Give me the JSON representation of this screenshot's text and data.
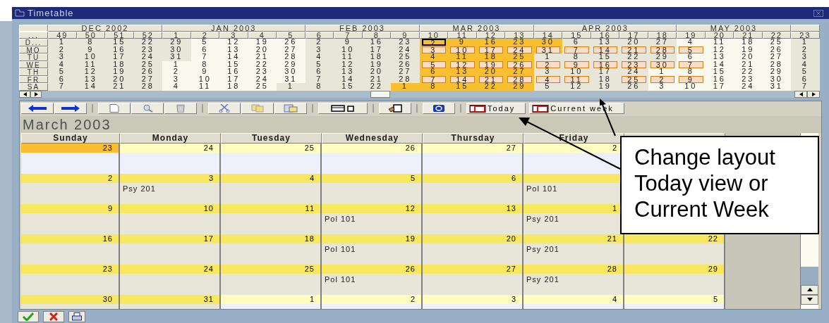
{
  "window": {
    "title": "Timetable"
  },
  "year_calendar": {
    "corner_label": "...",
    "day_labels": [
      "D...",
      "MO",
      "TU",
      "WE",
      "TH",
      "FR",
      "SA"
    ],
    "months": [
      {
        "label": "DEC 2002",
        "weeks": [
          {
            "number": "49",
            "days": [
              {
                "text": "1",
                "kind": "dark",
                "marked": false,
                "selected": false
              },
              {
                "text": "2",
                "kind": "dark",
                "marked": false,
                "selected": false
              },
              {
                "text": "3",
                "kind": "dark",
                "marked": false,
                "selected": false
              },
              {
                "text": "4",
                "kind": "dark",
                "marked": false,
                "selected": false
              },
              {
                "text": "5",
                "kind": "dark",
                "marked": false,
                "selected": false
              },
              {
                "text": "6",
                "kind": "dark",
                "marked": false,
                "selected": false
              },
              {
                "text": "7",
                "kind": "dark",
                "marked": false,
                "selected": false
              }
            ]
          },
          {
            "number": "50",
            "days": [
              {
                "text": "8",
                "kind": "dark",
                "marked": false,
                "selected": false
              },
              {
                "text": "9",
                "kind": "dark",
                "marked": false,
                "selected": false
              },
              {
                "text": "10",
                "kind": "dark",
                "marked": false,
                "selected": false
              },
              {
                "text": "11",
                "kind": "dark",
                "marked": false,
                "selected": false
              },
              {
                "text": "12",
                "kind": "dark",
                "marked": false,
                "selected": false
              },
              {
                "text": "13",
                "kind": "dark",
                "marked": false,
                "selected": false
              },
              {
                "text": "14",
                "kind": "dark",
                "marked": false,
                "selected": false
              }
            ]
          },
          {
            "number": "51",
            "days": [
              {
                "text": "15",
                "kind": "dark",
                "marked": false,
                "selected": false
              },
              {
                "text": "16",
                "kind": "dark",
                "marked": false,
                "selected": false
              },
              {
                "text": "17",
                "kind": "dark",
                "marked": false,
                "selected": false
              },
              {
                "text": "18",
                "kind": "dark",
                "marked": false,
                "selected": false
              },
              {
                "text": "19",
                "kind": "dark",
                "marked": false,
                "selected": false
              },
              {
                "text": "20",
                "kind": "dark",
                "marked": false,
                "selected": false
              },
              {
                "text": "21",
                "kind": "dark",
                "marked": false,
                "selected": false
              }
            ]
          },
          {
            "number": "52",
            "days": [
              {
                "text": "22",
                "kind": "dark",
                "marked": false,
                "selected": false
              },
              {
                "text": "23",
                "kind": "dark",
                "marked": false,
                "selected": false
              },
              {
                "text": "24",
                "kind": "dark",
                "marked": false,
                "selected": false
              },
              {
                "text": "25",
                "kind": "dark",
                "marked": false,
                "selected": false
              },
              {
                "text": "26",
                "kind": "dark",
                "marked": false,
                "selected": false
              },
              {
                "text": "27",
                "kind": "dark",
                "marked": false,
                "selected": false
              },
              {
                "text": "28",
                "kind": "dark",
                "marked": false,
                "selected": false
              }
            ]
          }
        ]
      },
      {
        "label": "JAN 2003",
        "weeks": [
          {
            "number": "1",
            "days": [
              {
                "text": "29",
                "kind": "dark",
                "marked": false,
                "selected": false
              },
              {
                "text": "30",
                "kind": "dark",
                "marked": false,
                "selected": false
              },
              {
                "text": "31",
                "kind": "dark",
                "marked": false,
                "selected": false
              },
              {
                "text": "1",
                "kind": "light",
                "marked": false,
                "selected": false
              },
              {
                "text": "2",
                "kind": "light",
                "marked": false,
                "selected": false
              },
              {
                "text": "3",
                "kind": "light",
                "marked": false,
                "selected": false
              },
              {
                "text": "4",
                "kind": "light",
                "marked": false,
                "selected": false
              }
            ]
          },
          {
            "number": "2",
            "days": [
              {
                "text": "5",
                "kind": "light",
                "marked": false,
                "selected": false
              },
              {
                "text": "6",
                "kind": "light",
                "marked": false,
                "selected": false
              },
              {
                "text": "7",
                "kind": "light",
                "marked": false,
                "selected": false
              },
              {
                "text": "8",
                "kind": "light",
                "marked": false,
                "selected": false
              },
              {
                "text": "9",
                "kind": "light",
                "marked": false,
                "selected": false
              },
              {
                "text": "10",
                "kind": "light",
                "marked": false,
                "selected": false
              },
              {
                "text": "11",
                "kind": "light",
                "marked": false,
                "selected": false
              }
            ]
          },
          {
            "number": "3",
            "days": [
              {
                "text": "12",
                "kind": "light",
                "marked": false,
                "selected": false
              },
              {
                "text": "13",
                "kind": "light",
                "marked": false,
                "selected": false
              },
              {
                "text": "14",
                "kind": "light",
                "marked": false,
                "selected": false
              },
              {
                "text": "15",
                "kind": "light",
                "marked": false,
                "selected": false
              },
              {
                "text": "16",
                "kind": "light",
                "marked": false,
                "selected": false
              },
              {
                "text": "17",
                "kind": "light",
                "marked": false,
                "selected": false
              },
              {
                "text": "18",
                "kind": "light",
                "marked": false,
                "selected": false
              }
            ]
          },
          {
            "number": "4",
            "days": [
              {
                "text": "19",
                "kind": "light",
                "marked": false,
                "selected": false
              },
              {
                "text": "20",
                "kind": "light",
                "marked": false,
                "selected": false
              },
              {
                "text": "21",
                "kind": "light",
                "marked": false,
                "selected": false
              },
              {
                "text": "22",
                "kind": "light",
                "marked": false,
                "selected": false
              },
              {
                "text": "23",
                "kind": "light",
                "marked": false,
                "selected": false
              },
              {
                "text": "24",
                "kind": "light",
                "marked": false,
                "selected": false
              },
              {
                "text": "25",
                "kind": "light",
                "marked": false,
                "selected": false
              }
            ]
          },
          {
            "number": "5",
            "days": [
              {
                "text": "26",
                "kind": "light",
                "marked": false,
                "selected": false
              },
              {
                "text": "27",
                "kind": "light",
                "marked": false,
                "selected": false
              },
              {
                "text": "28",
                "kind": "light",
                "marked": false,
                "selected": false
              },
              {
                "text": "29",
                "kind": "light",
                "marked": false,
                "selected": false
              },
              {
                "text": "30",
                "kind": "light",
                "marked": false,
                "selected": false
              },
              {
                "text": "31",
                "kind": "light",
                "marked": false,
                "selected": false
              },
              {
                "text": "1",
                "kind": "dark",
                "marked": false,
                "selected": false
              }
            ]
          }
        ]
      },
      {
        "label": "FEB 2003",
        "weeks": [
          {
            "number": "6",
            "days": [
              {
                "text": "2",
                "kind": "dark",
                "marked": false,
                "selected": false
              },
              {
                "text": "3",
                "kind": "dark",
                "marked": false,
                "selected": false
              },
              {
                "text": "4",
                "kind": "dark",
                "marked": false,
                "selected": false
              },
              {
                "text": "5",
                "kind": "dark",
                "marked": false,
                "selected": false
              },
              {
                "text": "6",
                "kind": "dark",
                "marked": false,
                "selected": false
              },
              {
                "text": "7",
                "kind": "dark",
                "marked": false,
                "selected": false
              },
              {
                "text": "8",
                "kind": "dark",
                "marked": false,
                "selected": false
              }
            ]
          },
          {
            "number": "7",
            "days": [
              {
                "text": "9",
                "kind": "dark",
                "marked": false,
                "selected": false
              },
              {
                "text": "10",
                "kind": "dark",
                "marked": false,
                "selected": false
              },
              {
                "text": "11",
                "kind": "dark",
                "marked": false,
                "selected": false
              },
              {
                "text": "12",
                "kind": "dark",
                "marked": false,
                "selected": false
              },
              {
                "text": "13",
                "kind": "dark",
                "marked": false,
                "selected": false
              },
              {
                "text": "14",
                "kind": "dark",
                "marked": false,
                "selected": false
              },
              {
                "text": "15",
                "kind": "dark",
                "marked": false,
                "selected": false
              }
            ]
          },
          {
            "number": "8",
            "days": [
              {
                "text": "16",
                "kind": "dark",
                "marked": false,
                "selected": false
              },
              {
                "text": "17",
                "kind": "dark",
                "marked": false,
                "selected": false
              },
              {
                "text": "18",
                "kind": "dark",
                "marked": false,
                "selected": false
              },
              {
                "text": "19",
                "kind": "dark",
                "marked": false,
                "selected": false
              },
              {
                "text": "20",
                "kind": "dark",
                "marked": false,
                "selected": false
              },
              {
                "text": "21",
                "kind": "dark",
                "marked": false,
                "selected": false
              },
              {
                "text": "22",
                "kind": "dark",
                "marked": false,
                "selected": false
              }
            ]
          },
          {
            "number": "9",
            "days": [
              {
                "text": "23",
                "kind": "dark",
                "marked": false,
                "selected": false
              },
              {
                "text": "24",
                "kind": "dark",
                "marked": false,
                "selected": false
              },
              {
                "text": "25",
                "kind": "dark",
                "marked": false,
                "selected": false
              },
              {
                "text": "26",
                "kind": "dark",
                "marked": false,
                "selected": false
              },
              {
                "text": "27",
                "kind": "dark",
                "marked": false,
                "selected": false
              },
              {
                "text": "28",
                "kind": "dark",
                "marked": false,
                "selected": false
              },
              {
                "text": "1",
                "kind": "highlight",
                "marked": false,
                "selected": false
              }
            ]
          }
        ]
      },
      {
        "label": "MAR 2003",
        "weeks": [
          {
            "number": "10",
            "days": [
              {
                "text": "2",
                "kind": "highlight",
                "marked": false,
                "selected": true
              },
              {
                "text": "3",
                "kind": "highlight",
                "marked": true,
                "selected": false
              },
              {
                "text": "4",
                "kind": "highlight",
                "marked": false,
                "selected": false
              },
              {
                "text": "5",
                "kind": "highlight",
                "marked": true,
                "selected": false
              },
              {
                "text": "6",
                "kind": "highlight",
                "marked": false,
                "selected": false
              },
              {
                "text": "7",
                "kind": "highlight",
                "marked": true,
                "selected": false
              },
              {
                "text": "8",
                "kind": "highlight",
                "marked": false,
                "selected": false
              }
            ]
          },
          {
            "number": "11",
            "days": [
              {
                "text": "9",
                "kind": "highlight",
                "marked": false,
                "selected": false
              },
              {
                "text": "10",
                "kind": "highlight",
                "marked": true,
                "selected": false
              },
              {
                "text": "11",
                "kind": "highlight",
                "marked": false,
                "selected": false
              },
              {
                "text": "12",
                "kind": "highlight",
                "marked": true,
                "selected": false
              },
              {
                "text": "13",
                "kind": "highlight",
                "marked": false,
                "selected": false
              },
              {
                "text": "14",
                "kind": "highlight",
                "marked": true,
                "selected": false
              },
              {
                "text": "15",
                "kind": "highlight",
                "marked": false,
                "selected": false
              }
            ]
          },
          {
            "number": "12",
            "days": [
              {
                "text": "16",
                "kind": "highlight",
                "marked": false,
                "selected": false
              },
              {
                "text": "17",
                "kind": "highlight",
                "marked": true,
                "selected": false
              },
              {
                "text": "18",
                "kind": "highlight",
                "marked": false,
                "selected": false
              },
              {
                "text": "19",
                "kind": "highlight",
                "marked": true,
                "selected": false
              },
              {
                "text": "20",
                "kind": "highlight",
                "marked": false,
                "selected": false
              },
              {
                "text": "21",
                "kind": "highlight",
                "marked": true,
                "selected": false
              },
              {
                "text": "22",
                "kind": "highlight",
                "marked": false,
                "selected": false
              }
            ]
          },
          {
            "number": "13",
            "days": [
              {
                "text": "23",
                "kind": "highlight",
                "marked": false,
                "selected": false
              },
              {
                "text": "24",
                "kind": "highlight",
                "marked": true,
                "selected": false
              },
              {
                "text": "25",
                "kind": "highlight",
                "marked": false,
                "selected": false
              },
              {
                "text": "26",
                "kind": "highlight",
                "marked": true,
                "selected": false
              },
              {
                "text": "27",
                "kind": "highlight",
                "marked": false,
                "selected": false
              },
              {
                "text": "28",
                "kind": "highlight",
                "marked": true,
                "selected": false
              },
              {
                "text": "29",
                "kind": "highlight",
                "marked": false,
                "selected": false
              }
            ]
          }
        ]
      },
      {
        "label": "APR 2003",
        "weeks": [
          {
            "number": "14",
            "days": [
              {
                "text": "30",
                "kind": "highlight",
                "marked": false,
                "selected": false
              },
              {
                "text": "31",
                "kind": "highlight",
                "marked": true,
                "selected": false
              },
              {
                "text": "1",
                "kind": "dark",
                "marked": false,
                "selected": false
              },
              {
                "text": "2",
                "kind": "dark",
                "marked": true,
                "selected": false
              },
              {
                "text": "3",
                "kind": "dark",
                "marked": false,
                "selected": false
              },
              {
                "text": "4",
                "kind": "dark",
                "marked": true,
                "selected": false
              },
              {
                "text": "5",
                "kind": "dark",
                "marked": false,
                "selected": false
              }
            ]
          },
          {
            "number": "15",
            "days": [
              {
                "text": "6",
                "kind": "dark",
                "marked": false,
                "selected": false
              },
              {
                "text": "7",
                "kind": "dark",
                "marked": true,
                "selected": false
              },
              {
                "text": "8",
                "kind": "dark",
                "marked": false,
                "selected": false
              },
              {
                "text": "9",
                "kind": "dark",
                "marked": true,
                "selected": false
              },
              {
                "text": "10",
                "kind": "dark",
                "marked": false,
                "selected": false
              },
              {
                "text": "11",
                "kind": "dark",
                "marked": true,
                "selected": false
              },
              {
                "text": "12",
                "kind": "dark",
                "marked": false,
                "selected": false
              }
            ]
          },
          {
            "number": "16",
            "days": [
              {
                "text": "13",
                "kind": "dark",
                "marked": false,
                "selected": false
              },
              {
                "text": "14",
                "kind": "dark",
                "marked": true,
                "selected": false
              },
              {
                "text": "15",
                "kind": "dark",
                "marked": false,
                "selected": false
              },
              {
                "text": "16",
                "kind": "dark",
                "marked": true,
                "selected": false
              },
              {
                "text": "17",
                "kind": "dark",
                "marked": false,
                "selected": false
              },
              {
                "text": "18",
                "kind": "dark",
                "marked": false,
                "selected": false
              },
              {
                "text": "19",
                "kind": "dark",
                "marked": false,
                "selected": false
              }
            ]
          },
          {
            "number": "17",
            "days": [
              {
                "text": "20",
                "kind": "dark",
                "marked": false,
                "selected": false
              },
              {
                "text": "21",
                "kind": "dark",
                "marked": true,
                "selected": false
              },
              {
                "text": "22",
                "kind": "dark",
                "marked": false,
                "selected": false
              },
              {
                "text": "23",
                "kind": "dark",
                "marked": true,
                "selected": false
              },
              {
                "text": "24",
                "kind": "dark",
                "marked": false,
                "selected": false
              },
              {
                "text": "25",
                "kind": "dark",
                "marked": true,
                "selected": false
              },
              {
                "text": "26",
                "kind": "dark",
                "marked": false,
                "selected": false
              }
            ]
          },
          {
            "number": "18",
            "days": [
              {
                "text": "27",
                "kind": "dark",
                "marked": false,
                "selected": false
              },
              {
                "text": "28",
                "kind": "dark",
                "marked": true,
                "selected": false
              },
              {
                "text": "29",
                "kind": "dark",
                "marked": false,
                "selected": false
              },
              {
                "text": "30",
                "kind": "dark",
                "marked": true,
                "selected": false
              },
              {
                "text": "1",
                "kind": "light",
                "marked": false,
                "selected": false
              },
              {
                "text": "2",
                "kind": "light",
                "marked": true,
                "selected": false
              },
              {
                "text": "3",
                "kind": "light",
                "marked": false,
                "selected": false
              }
            ]
          }
        ]
      },
      {
        "label": "MAY 2003",
        "weeks": [
          {
            "number": "19",
            "days": [
              {
                "text": "4",
                "kind": "light",
                "marked": false,
                "selected": false
              },
              {
                "text": "5",
                "kind": "light",
                "marked": true,
                "selected": false
              },
              {
                "text": "6",
                "kind": "light",
                "marked": false,
                "selected": false
              },
              {
                "text": "7",
                "kind": "light",
                "marked": true,
                "selected": false
              },
              {
                "text": "8",
                "kind": "light",
                "marked": false,
                "selected": false
              },
              {
                "text": "9",
                "kind": "light",
                "marked": true,
                "selected": false
              },
              {
                "text": "10",
                "kind": "light",
                "marked": false,
                "selected": false
              }
            ]
          },
          {
            "number": "20",
            "days": [
              {
                "text": "11",
                "kind": "light",
                "marked": false,
                "selected": false
              },
              {
                "text": "12",
                "kind": "light",
                "marked": false,
                "selected": false
              },
              {
                "text": "13",
                "kind": "light",
                "marked": false,
                "selected": false
              },
              {
                "text": "14",
                "kind": "light",
                "marked": false,
                "selected": false
              },
              {
                "text": "15",
                "kind": "light",
                "marked": false,
                "selected": false
              },
              {
                "text": "16",
                "kind": "light",
                "marked": false,
                "selected": false
              },
              {
                "text": "17",
                "kind": "light",
                "marked": false,
                "selected": false
              }
            ]
          },
          {
            "number": "21",
            "days": [
              {
                "text": "18",
                "kind": "light",
                "marked": false,
                "selected": false
              },
              {
                "text": "19",
                "kind": "light",
                "marked": false,
                "selected": false
              },
              {
                "text": "20",
                "kind": "light",
                "marked": false,
                "selected": false
              },
              {
                "text": "21",
                "kind": "light",
                "marked": false,
                "selected": false
              },
              {
                "text": "22",
                "kind": "light",
                "marked": false,
                "selected": false
              },
              {
                "text": "23",
                "kind": "light",
                "marked": false,
                "selected": false
              },
              {
                "text": "24",
                "kind": "light",
                "marked": false,
                "selected": false
              }
            ]
          },
          {
            "number": "22",
            "days": [
              {
                "text": "25",
                "kind": "light",
                "marked": false,
                "selected": false
              },
              {
                "text": "26",
                "kind": "light",
                "marked": false,
                "selected": false
              },
              {
                "text": "27",
                "kind": "light",
                "marked": false,
                "selected": false
              },
              {
                "text": "28",
                "kind": "light",
                "marked": false,
                "selected": false
              },
              {
                "text": "29",
                "kind": "light",
                "marked": false,
                "selected": false
              },
              {
                "text": "30",
                "kind": "light",
                "marked": false,
                "selected": false
              },
              {
                "text": "31",
                "kind": "light",
                "marked": false,
                "selected": false
              }
            ]
          }
        ]
      },
      {
        "weeks": [
          {
            "number": "23",
            "days": [
              {
                "text": "1",
                "kind": "dark",
                "marked": false,
                "selected": false
              },
              {
                "text": "2",
                "kind": "dark",
                "marked": false,
                "selected": false
              },
              {
                "text": "3",
                "kind": "dark",
                "marked": false,
                "selected": false
              },
              {
                "text": "4",
                "kind": "dark",
                "marked": false,
                "selected": false
              },
              {
                "text": "5",
                "kind": "dark",
                "marked": false,
                "selected": false
              },
              {
                "text": "6",
                "kind": "dark",
                "marked": false,
                "selected": false
              },
              {
                "text": "7",
                "kind": "dark",
                "marked": false,
                "selected": false
              }
            ]
          }
        ]
      }
    ]
  },
  "toolbar": {
    "buttons": [
      {
        "label": "Today"
      },
      {
        "label": "Current week"
      }
    ]
  },
  "month_view": {
    "title": "March 2003",
    "weekdays": [
      "Sunday",
      "Monday",
      "Tuesday",
      "Wednesday",
      "Thursday",
      "Friday"
    ],
    "weeks": [
      {
        "days": [
          {
            "date": "23",
            "in_month": false,
            "selected": true
          },
          {
            "date": "24",
            "in_month": false,
            "selected": false
          },
          {
            "date": "25",
            "in_month": false,
            "selected": false
          },
          {
            "date": "26",
            "in_month": false,
            "selected": false
          },
          {
            "date": "27",
            "in_month": false,
            "selected": false
          },
          {
            "date": "2",
            "in_month": false,
            "selected": false
          }
        ]
      },
      {
        "days": [
          {
            "date": "2",
            "in_month": true,
            "selected": false
          },
          {
            "date": "3",
            "in_month": true,
            "selected": false,
            "event": "Psy 201"
          },
          {
            "date": "4",
            "in_month": true,
            "selected": false
          },
          {
            "date": "5",
            "in_month": true,
            "selected": false
          },
          {
            "date": "6",
            "in_month": true,
            "selected": false
          },
          {
            "in_month": true,
            "selected": false,
            "event": "Pol 101"
          }
        ]
      },
      {
        "days": [
          {
            "date": "9",
            "in_month": true,
            "selected": false
          },
          {
            "date": "10",
            "in_month": true,
            "selected": false
          },
          {
            "date": "11",
            "in_month": true,
            "selected": false
          },
          {
            "date": "12",
            "in_month": true,
            "selected": false,
            "event": "Pol 101"
          },
          {
            "date": "13",
            "in_month": true,
            "selected": false
          },
          {
            "date": "1",
            "in_month": true,
            "selected": false,
            "event": "Psy 201"
          }
        ]
      },
      {
        "days": [
          {
            "date": "16",
            "in_month": true,
            "selected": false
          },
          {
            "date": "17",
            "in_month": true,
            "selected": false
          },
          {
            "date": "18",
            "in_month": true,
            "selected": false
          },
          {
            "date": "19",
            "in_month": true,
            "selected": false,
            "event": "Pol 101"
          },
          {
            "date": "20",
            "in_month": true,
            "selected": false
          },
          {
            "date": "21",
            "in_month": true,
            "selected": false,
            "event": "Psy 201"
          },
          {
            "date": "22",
            "in_month": true,
            "selected": false
          }
        ]
      },
      {
        "days": [
          {
            "date": "23",
            "in_month": true,
            "selected": false
          },
          {
            "date": "24",
            "in_month": true,
            "selected": false
          },
          {
            "date": "25",
            "in_month": true,
            "selected": false
          },
          {
            "date": "26",
            "in_month": true,
            "selected": false,
            "event": "Pol 101"
          },
          {
            "date": "27",
            "in_month": true,
            "selected": false
          },
          {
            "date": "28",
            "in_month": true,
            "selected": false,
            "event": "Psy 201"
          },
          {
            "date": "29",
            "in_month": true,
            "selected": false
          }
        ]
      },
      {
        "days": [
          {
            "date": "30",
            "in_month": true,
            "selected": false
          },
          {
            "date": "31",
            "in_month": true,
            "selected": false
          },
          {
            "date": "1",
            "in_month": false,
            "selected": false
          },
          {
            "date": "2",
            "in_month": false,
            "selected": false
          },
          {
            "date": "3",
            "in_month": false,
            "selected": false
          },
          {
            "date": "4",
            "in_month": false,
            "selected": false
          },
          {
            "date": "5",
            "in_month": false,
            "selected": false
          }
        ]
      }
    ]
  },
  "callout": {
    "text": "Change layout\nToday view or\nCurrent Week"
  }
}
